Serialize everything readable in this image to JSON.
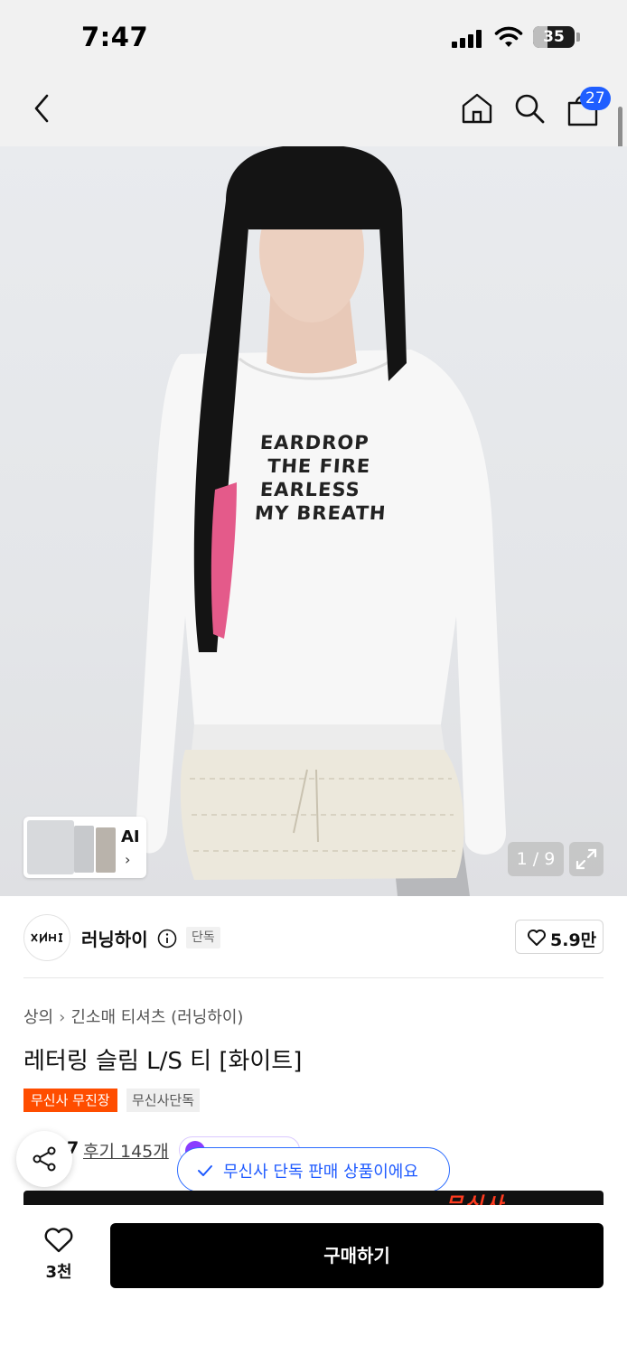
{
  "status_bar": {
    "time": "7:47",
    "battery": "35",
    "battery_level": 0.35,
    "icons": [
      "signal-icon",
      "wifi-icon",
      "battery-icon"
    ]
  },
  "nav": {
    "icons": [
      "back-arrow-icon",
      "home-icon",
      "search-icon",
      "shopping-bag-icon"
    ],
    "cart_count": "27"
  },
  "gallery": {
    "shirt_lines": [
      "EARDROP",
      "THE FIRE",
      "EARLESS",
      "MY BREATH"
    ],
    "thumb_label": "AI",
    "thumb_chevron": "›",
    "page_indicator": "1 / 9"
  },
  "brand": {
    "name": "러닝하이",
    "tag": "단독",
    "likes": "5.9만"
  },
  "product": {
    "breadcrumb": [
      "상의",
      "긴소매 티셔츠 (러닝하이)"
    ],
    "breadcrumb_sep": "›",
    "title": "레터링 슬림 L/S 티 [화이트]",
    "badges": [
      "무신사 무진장",
      "무신사단독"
    ],
    "rating_star": "★",
    "rating": "7",
    "review_count": "후기 145개"
  },
  "toast": {
    "message": "무신사 단독 판매 상품이에요"
  },
  "banner": {
    "text": "무신사"
  },
  "bottom_bar": {
    "like_count": "3천",
    "buy_label": "구매하기"
  },
  "colors": {
    "accent_blue": "#1f5eff",
    "orange_badge": "#ff4d00",
    "buy_button": "#000000"
  }
}
